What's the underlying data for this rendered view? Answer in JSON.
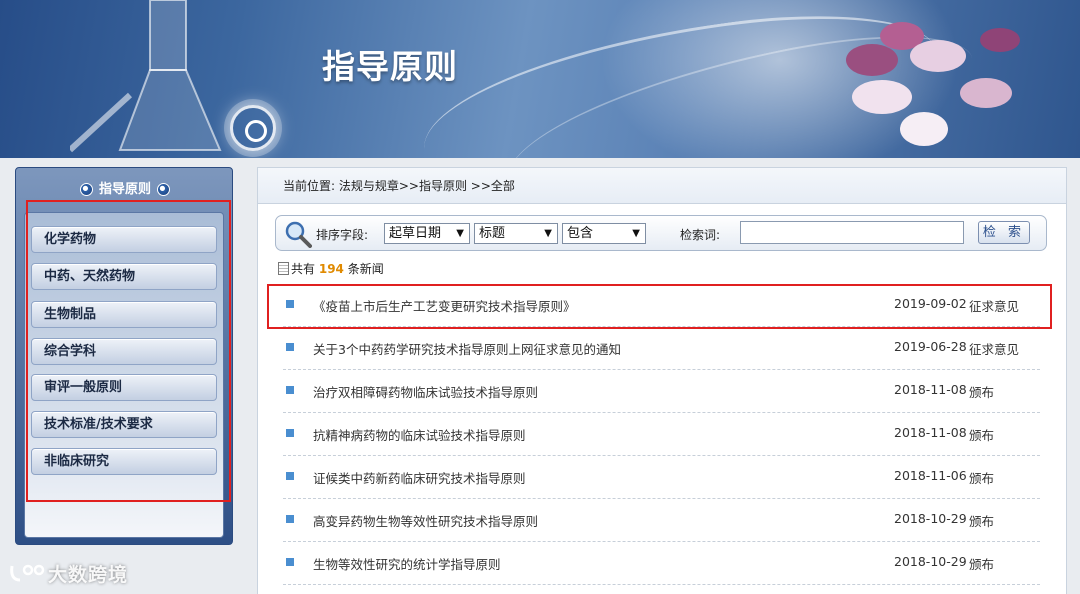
{
  "banner": {
    "title": "指导原则"
  },
  "sidebar": {
    "heading": "指导原则",
    "items": [
      {
        "label": "化学药物"
      },
      {
        "label": "中药、天然药物"
      },
      {
        "label": "生物制品"
      },
      {
        "label": "综合学科"
      },
      {
        "label": "审评一般原则"
      },
      {
        "label": "技术标准/技术要求"
      },
      {
        "label": "非临床研究"
      }
    ]
  },
  "breadcrumb": {
    "text": "当前位置:  法规与规章>>指导原则 >>全部"
  },
  "search": {
    "sort_label": "排序字段:",
    "sort_value": "起草日期",
    "field_value": "标题",
    "match_value": "包含",
    "keyword_label": "检索词:",
    "keyword_value": "",
    "button_label": "检 索"
  },
  "summary": {
    "prefix": "共有",
    "count": "194",
    "suffix": "条新闻"
  },
  "news": [
    {
      "title": "《疫苗上市后生产工艺变更研究技术指导原则》",
      "date": "2019-09-02",
      "status": "征求意见"
    },
    {
      "title": "关于3个中药药学研究技术指导原则上网征求意见的通知",
      "date": "2019-06-28",
      "status": "征求意见"
    },
    {
      "title": "治疗双相障碍药物临床试验技术指导原则",
      "date": "2018-11-08",
      "status": "颁布"
    },
    {
      "title": "抗精神病药物的临床试验技术指导原则",
      "date": "2018-11-08",
      "status": "颁布"
    },
    {
      "title": "证候类中药新药临床研究技术指导原则",
      "date": "2018-11-06",
      "status": "颁布"
    },
    {
      "title": "高变异药物生物等效性研究技术指导原则",
      "date": "2018-10-29",
      "status": "颁布"
    },
    {
      "title": "生物等效性研究的统计学指导原则",
      "date": "2018-10-29",
      "status": "颁布"
    }
  ],
  "watermark": {
    "text": "大数跨境"
  },
  "colors": {
    "highlight": "#e02020",
    "bullet": "#4a8ed0",
    "count": "#e08a00",
    "banner": "#3c679f"
  }
}
